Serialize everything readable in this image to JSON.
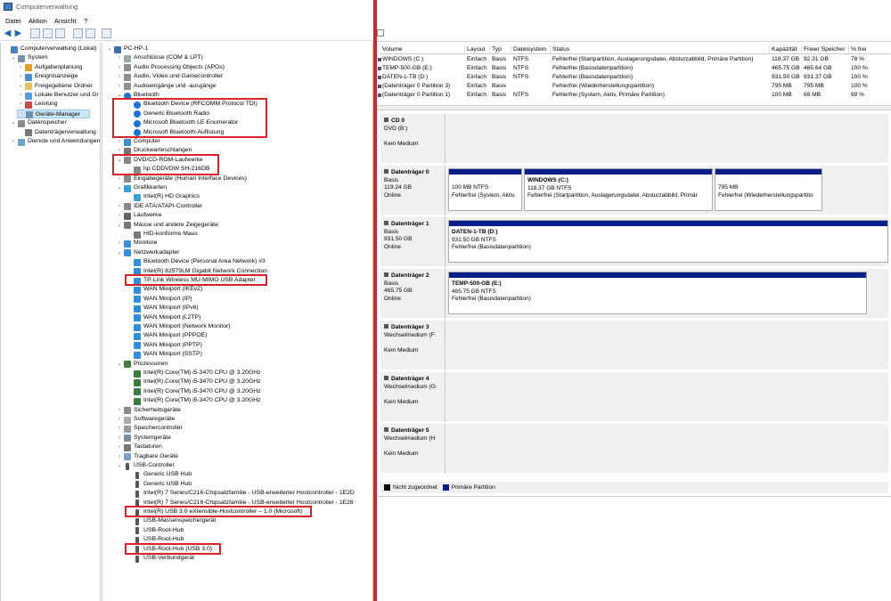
{
  "window": {
    "title": "Computerverwaltung"
  },
  "menu": [
    "Datei",
    "Aktion",
    "Ansicht",
    "?"
  ],
  "left_tree": [
    {
      "label": "Computerverwaltung (Lokal)",
      "exp": "",
      "icon": "computer-mgmt-icon",
      "depth": 0
    },
    {
      "label": "System",
      "exp": "v",
      "icon": "tools-icon",
      "depth": 1
    },
    {
      "label": "Aufgabenplanung",
      "exp": ">",
      "icon": "clock-icon",
      "depth": 2
    },
    {
      "label": "Ereignisanzeige",
      "exp": ">",
      "icon": "event-icon",
      "depth": 2
    },
    {
      "label": "Freigegebene Ordner",
      "exp": ">",
      "icon": "folder-icon",
      "depth": 2
    },
    {
      "label": "Lokale Benutzer und Gr",
      "exp": ">",
      "icon": "users-icon",
      "depth": 2
    },
    {
      "label": "Leistung",
      "exp": ">",
      "icon": "performance-icon",
      "depth": 2
    },
    {
      "label": "Geräte-Manager",
      "exp": "",
      "icon": "device-manager-icon",
      "depth": 2,
      "selected": true
    },
    {
      "label": "Datenspeicher",
      "exp": "v",
      "icon": "storage-icon",
      "depth": 1
    },
    {
      "label": "Datenträgerverwaltung",
      "exp": "",
      "icon": "disk-icon",
      "depth": 2
    },
    {
      "label": "Dienste und Anwendungen",
      "exp": ">",
      "icon": "services-icon",
      "depth": 1
    }
  ],
  "device_tree": [
    {
      "label": "PC-HP-1",
      "exp": "v",
      "icon": "computer-icon",
      "depth": 0
    },
    {
      "label": "Anschlüsse (COM & LPT)",
      "exp": ">",
      "icon": "port-icon",
      "depth": 1
    },
    {
      "label": "Audio Processing Objects (APOs)",
      "exp": ">",
      "icon": "audio-icon",
      "depth": 1
    },
    {
      "label": "Audio, Video und Gamecontroller",
      "exp": ">",
      "icon": "audio-icon",
      "depth": 1
    },
    {
      "label": "Audioeingänge und -ausgänge",
      "exp": ">",
      "icon": "audio-icon",
      "depth": 1
    },
    {
      "label": "Bluetooth",
      "exp": "v",
      "icon": "bluetooth-icon",
      "depth": 1
    },
    {
      "label": "Bluetooth Device (RFCOMM Protocol TDI)",
      "exp": "",
      "icon": "bluetooth-icon",
      "depth": 2
    },
    {
      "label": "Generic Bluetooth Radio",
      "exp": "",
      "icon": "bluetooth-icon",
      "depth": 2
    },
    {
      "label": "Microsoft Bluetooth LE-Enumerator",
      "exp": "",
      "icon": "bluetooth-icon",
      "depth": 2
    },
    {
      "label": "Microsoft Bluetooth-Auflistung",
      "exp": "",
      "icon": "bluetooth-icon",
      "depth": 2
    },
    {
      "label": "Computer",
      "exp": ">",
      "icon": "monitor-icon",
      "depth": 1
    },
    {
      "label": "Druckwarteschlangen",
      "exp": ">",
      "icon": "printer-icon",
      "depth": 1
    },
    {
      "label": "DVD/CD-ROM-Laufwerke",
      "exp": "v",
      "icon": "dvd-icon",
      "depth": 1
    },
    {
      "label": "hp CDDVDW SH-216DB",
      "exp": "",
      "icon": "dvd-icon",
      "depth": 2
    },
    {
      "label": "Eingabegeräte (Human Interface Devices)",
      "exp": ">",
      "icon": "hid-icon",
      "depth": 1
    },
    {
      "label": "Grafikkarten",
      "exp": "v",
      "icon": "display-adapter-icon",
      "depth": 1
    },
    {
      "label": "Intel(R) HD Graphics",
      "exp": "",
      "icon": "display-adapter-icon",
      "depth": 2
    },
    {
      "label": "IDE ATA/ATAPI-Controller",
      "exp": ">",
      "icon": "ide-icon",
      "depth": 1
    },
    {
      "label": "Laufwerke",
      "exp": ">",
      "icon": "drive-icon",
      "depth": 1
    },
    {
      "label": "Mäuse und andere Zeigegeräte",
      "exp": "v",
      "icon": "mouse-icon",
      "depth": 1
    },
    {
      "label": "HID-konforme Maus",
      "exp": "",
      "icon": "mouse-icon",
      "depth": 2
    },
    {
      "label": "Monitore",
      "exp": ">",
      "icon": "monitor-icon",
      "depth": 1
    },
    {
      "label": "Netzwerkadapter",
      "exp": "v",
      "icon": "network-icon",
      "depth": 1
    },
    {
      "label": "Bluetooth Device (Personal Area Network) #3",
      "exp": "",
      "icon": "network-icon",
      "depth": 2
    },
    {
      "label": "Intel(R) 82579LM Gigabit Network Connection",
      "exp": "",
      "icon": "network-icon",
      "depth": 2
    },
    {
      "label": "TP-Link Wireless MU-MIMO USB Adapter",
      "exp": "",
      "icon": "network-icon",
      "depth": 2
    },
    {
      "label": "WAN Miniport (IKEv2)",
      "exp": "",
      "icon": "network-icon",
      "depth": 2
    },
    {
      "label": "WAN Miniport (IP)",
      "exp": "",
      "icon": "network-icon",
      "depth": 2
    },
    {
      "label": "WAN Miniport (IPv6)",
      "exp": "",
      "icon": "network-icon",
      "depth": 2
    },
    {
      "label": "WAN Miniport (L2TP)",
      "exp": "",
      "icon": "network-icon",
      "depth": 2
    },
    {
      "label": "WAN Miniport (Network Monitor)",
      "exp": "",
      "icon": "network-icon",
      "depth": 2
    },
    {
      "label": "WAN Miniport (PPPOE)",
      "exp": "",
      "icon": "network-icon",
      "depth": 2
    },
    {
      "label": "WAN Miniport (PPTP)",
      "exp": "",
      "icon": "network-icon",
      "depth": 2
    },
    {
      "label": "WAN Miniport (SSTP)",
      "exp": "",
      "icon": "network-icon",
      "depth": 2
    },
    {
      "label": "Prozessoren",
      "exp": "v",
      "icon": "cpu-icon",
      "depth": 1
    },
    {
      "label": "Intel(R) Core(TM) i5-3470 CPU @ 3.20GHz",
      "exp": "",
      "icon": "cpu-icon",
      "depth": 2
    },
    {
      "label": "Intel(R) Core(TM) i5-3470 CPU @ 3.20GHz",
      "exp": "",
      "icon": "cpu-icon",
      "depth": 2
    },
    {
      "label": "Intel(R) Core(TM) i5-3470 CPU @ 3.20GHz",
      "exp": "",
      "icon": "cpu-icon",
      "depth": 2
    },
    {
      "label": "Intel(R) Core(TM) i5-3470 CPU @ 3.20GHz",
      "exp": "",
      "icon": "cpu-icon",
      "depth": 2
    },
    {
      "label": "Sicherheitsgeräte",
      "exp": ">",
      "icon": "security-icon",
      "depth": 1
    },
    {
      "label": "Softwaregeräte",
      "exp": ">",
      "icon": "software-icon",
      "depth": 1
    },
    {
      "label": "Speichercontroller",
      "exp": ">",
      "icon": "storage-controller-icon",
      "depth": 1
    },
    {
      "label": "Systemgeräte",
      "exp": ">",
      "icon": "system-icon",
      "depth": 1
    },
    {
      "label": "Tastaturen",
      "exp": ">",
      "icon": "keyboard-icon",
      "depth": 1
    },
    {
      "label": "Tragbare Geräte",
      "exp": ">",
      "icon": "portable-icon",
      "depth": 1
    },
    {
      "label": "USB-Controller",
      "exp": "v",
      "icon": "usb-icon",
      "depth": 1
    },
    {
      "label": "Generic USB Hub",
      "exp": "",
      "icon": "usb-icon",
      "depth": 2
    },
    {
      "label": "Generic USB Hub",
      "exp": "",
      "icon": "usb-icon",
      "depth": 2
    },
    {
      "label": "Intel(R) 7 Series/C216-Chipsatzfamilie - USB-erweiterter Hostcontroller - 1E2D",
      "exp": "",
      "icon": "usb-icon",
      "depth": 2
    },
    {
      "label": "Intel(R) 7 Series/C216-Chipsatzfamilie - USB-erweiterter Hostcontroller - 1E26",
      "exp": "",
      "icon": "usb-icon",
      "depth": 2
    },
    {
      "label": "Intel(R) USB 3.0 eXtensible-Hostcontroller – 1.0 (Microsoft)",
      "exp": "",
      "icon": "usb-icon",
      "depth": 2
    },
    {
      "label": "USB-Massenspeichergerät",
      "exp": "",
      "icon": "usb-icon",
      "depth": 2
    },
    {
      "label": "USB-Root-Hub",
      "exp": "",
      "icon": "usb-icon",
      "depth": 2
    },
    {
      "label": "USB-Root-Hub",
      "exp": "",
      "icon": "usb-icon",
      "depth": 2
    },
    {
      "label": "USB-Root-Hub (USB 3.0)",
      "exp": "",
      "icon": "usb-icon",
      "depth": 2
    },
    {
      "label": "USB-Verbundgerät",
      "exp": "",
      "icon": "usb-icon",
      "depth": 2
    }
  ],
  "volume_table": {
    "headers": [
      "Volume",
      "Layout",
      "Typ",
      "Dateisystem",
      "Status",
      "Kapazität",
      "Freier Speicher",
      "% frei"
    ],
    "rows": [
      [
        "WINDOWS (C:)",
        "Einfach",
        "Basis",
        "NTFS",
        "Fehlerfrei (Startpartition, Auslagerungsdatei, Absturzabbild, Primäre Partition)",
        "118.37 GB",
        "92.31 GB",
        "78 %"
      ],
      [
        "TEMP-500-GB (E:)",
        "Einfach",
        "Basis",
        "NTFS",
        "Fehlerfrei (Basisdatenpartition)",
        "465.75 GB",
        "465.64 GB",
        "100 %"
      ],
      [
        "DATEN-1-TB (D:)",
        "Einfach",
        "Basis",
        "NTFS",
        "Fehlerfrei (Basisdatenpartition)",
        "931.50 GB",
        "931.37 GB",
        "100 %"
      ],
      [
        "(Datenträger 0 Partition 3)",
        "Einfach",
        "Basis",
        "",
        "Fehlerfrei (Wiederherstellungspartition)",
        "795 MB",
        "795 MB",
        "100 %"
      ],
      [
        "(Datenträger 0 Partition 1)",
        "Einfach",
        "Basis",
        "NTFS",
        "Fehlerfrei (System, Aktiv, Primäre Partition)",
        "100 MB",
        "69 MB",
        "69 %"
      ]
    ]
  },
  "disks": [
    {
      "name": "CD 0",
      "lines": [
        "DVD (B:)",
        "",
        "Kein Medium"
      ],
      "partitions": []
    },
    {
      "name": "Datenträger 0",
      "lines": [
        "Basis",
        "119.24 GB",
        "Online"
      ],
      "partitions": [
        {
          "title": "",
          "lines": [
            "100 MB NTFS",
            "Fehlerfrei (System, Aktiv,"
          ]
        },
        {
          "title": "WINDOWS (C:)",
          "lines": [
            "118.37 GB NTFS",
            "Fehlerfrei (Startpartition, Auslagerungsdatei, Absturzabbild, Primär"
          ]
        },
        {
          "title": "",
          "lines": [
            "795 MB",
            "Fehlerfrei (Wiederherstellungspartitio"
          ]
        }
      ]
    },
    {
      "name": "Datenträger 1",
      "lines": [
        "Basis",
        "931.50 GB",
        "Online"
      ],
      "partitions": [
        {
          "title": "DATEN-1-TB (D:)",
          "lines": [
            "931.50 GB NTFS",
            "Fehlerfrei (Basisdatenpartition)"
          ]
        }
      ]
    },
    {
      "name": "Datenträger 2",
      "lines": [
        "Basis",
        "465.75 GB",
        "Online"
      ],
      "partitions": [
        {
          "title": "TEMP-500-GB (E:)",
          "lines": [
            "465.75 GB NTFS",
            "Fehlerfrei (Basisdatenpartition)"
          ]
        }
      ]
    },
    {
      "name": "Datenträger 3",
      "lines": [
        "Wechselmedium (F:",
        "",
        "Kein Medium"
      ],
      "partitions": []
    },
    {
      "name": "Datenträger 4",
      "lines": [
        "Wechselmedium (G:",
        "",
        "Kein Medium"
      ],
      "partitions": []
    },
    {
      "name": "Datenträger 5",
      "lines": [
        "Wechselmedium (H",
        "",
        "Kein Medium"
      ],
      "partitions": []
    }
  ],
  "legend": [
    "Nicht zugeordnet",
    "Primäre Partition"
  ],
  "colors": {
    "highlight": "#d8232a",
    "primary_partition": "#0a1e8c",
    "unallocated": "#000000"
  }
}
